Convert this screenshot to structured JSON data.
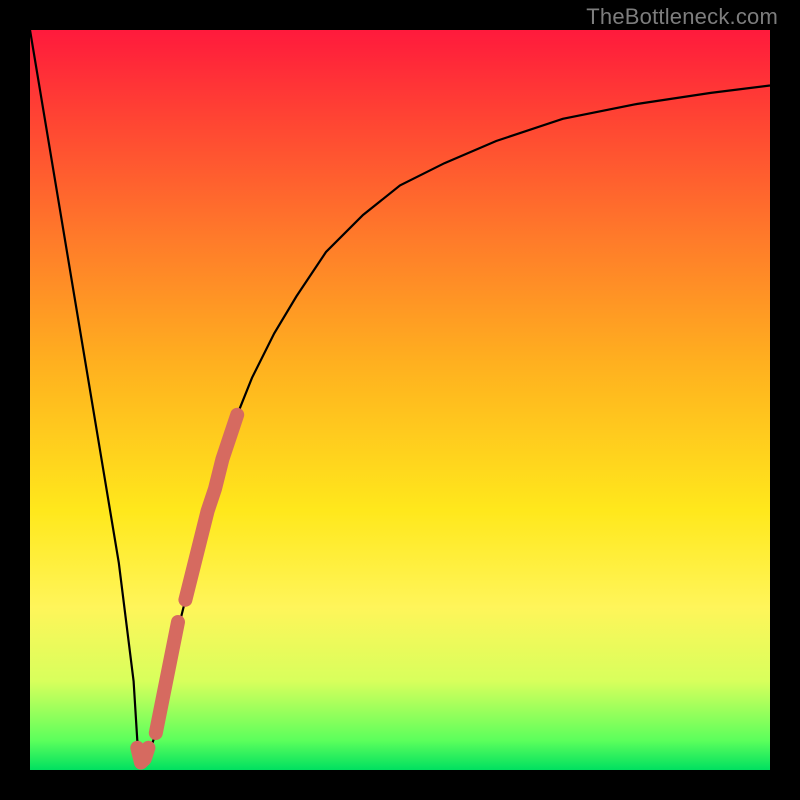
{
  "watermark": {
    "text": "TheBottleneck.com"
  },
  "gradient": {
    "stops": [
      {
        "offset": 0,
        "color": "#ff1a3c"
      },
      {
        "offset": 12,
        "color": "#ff4433"
      },
      {
        "offset": 28,
        "color": "#ff7a2a"
      },
      {
        "offset": 45,
        "color": "#ffb01f"
      },
      {
        "offset": 65,
        "color": "#ffe81c"
      },
      {
        "offset": 78,
        "color": "#fff55a"
      },
      {
        "offset": 88,
        "color": "#d8ff5c"
      },
      {
        "offset": 96,
        "color": "#5cff5c"
      },
      {
        "offset": 100,
        "color": "#00e060"
      }
    ]
  },
  "chart_data": {
    "type": "line",
    "title": "",
    "xlabel": "",
    "ylabel": "",
    "xlim": [
      0,
      100
    ],
    "ylim": [
      0,
      100
    ],
    "series": [
      {
        "name": "bottleneck-curve",
        "x": [
          0,
          2,
          4,
          6,
          8,
          10,
          12,
          14,
          14.5,
          15,
          16,
          17,
          18,
          20,
          22,
          24,
          26,
          28,
          30,
          33,
          36,
          40,
          45,
          50,
          56,
          63,
          72,
          82,
          92,
          100
        ],
        "values": [
          100,
          88,
          76,
          64,
          52,
          40,
          28,
          12,
          4,
          1,
          2,
          5,
          10,
          19,
          27,
          35,
          42,
          48,
          53,
          59,
          64,
          70,
          75,
          79,
          82,
          85,
          88,
          90,
          91.5,
          92.5
        ]
      }
    ],
    "markers": [
      {
        "name": "highlight-segment-upper",
        "x": [
          21,
          22,
          23,
          24,
          25,
          26,
          27,
          28
        ],
        "values": [
          23,
          27,
          31,
          35,
          38,
          42,
          45,
          48
        ]
      },
      {
        "name": "highlight-segment-lower",
        "x": [
          17,
          18,
          19,
          20
        ],
        "values": [
          5,
          10,
          15,
          20
        ]
      },
      {
        "name": "highlight-hook",
        "x": [
          14.5,
          15,
          15.5,
          16
        ],
        "values": [
          3,
          1,
          1.5,
          3
        ]
      }
    ]
  }
}
